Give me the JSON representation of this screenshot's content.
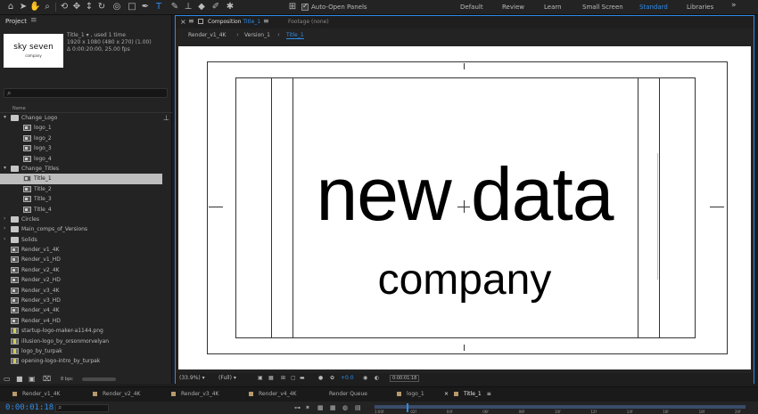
{
  "workspaces": {
    "auto_open": "Auto-Open Panels",
    "items": [
      "Default",
      "Review",
      "Learn",
      "Small Screen",
      "Standard",
      "Libraries"
    ],
    "active": "Standard"
  },
  "project": {
    "title": "Project",
    "thumb_line1": "sky seven",
    "thumb_line2": "company",
    "info": [
      "Title_1 ▾ , used 1 time",
      "1920 x 1080  (480 x 270) (1.00)",
      "Δ 0:00:20:00, 25.00 fps"
    ],
    "column_header": "Name",
    "items": [
      {
        "label": "Change_Logo",
        "type": "folder",
        "open": true,
        "depth": 0
      },
      {
        "label": "logo_1",
        "type": "comp",
        "depth": 1
      },
      {
        "label": "logo_2",
        "type": "comp",
        "depth": 1
      },
      {
        "label": "logo_3",
        "type": "comp",
        "depth": 1
      },
      {
        "label": "logo_4",
        "type": "comp",
        "depth": 1
      },
      {
        "label": "Change_Titles",
        "type": "folder",
        "open": true,
        "depth": 0
      },
      {
        "label": "Title_1",
        "type": "comp",
        "depth": 1,
        "selected": true
      },
      {
        "label": "Title_2",
        "type": "comp",
        "depth": 1
      },
      {
        "label": "Title_3",
        "type": "comp",
        "depth": 1
      },
      {
        "label": "Title_4",
        "type": "comp",
        "depth": 1
      },
      {
        "label": "Circles",
        "type": "folder",
        "open": false,
        "depth": 0
      },
      {
        "label": "Main_comps_of_Versions",
        "type": "folder",
        "open": false,
        "depth": 0
      },
      {
        "label": "Solids",
        "type": "folder",
        "open": false,
        "depth": 0
      },
      {
        "label": "Render_v1_4K",
        "type": "comp",
        "depth": 0
      },
      {
        "label": "Render_v1_HD",
        "type": "comp",
        "depth": 0
      },
      {
        "label": "Render_v2_4K",
        "type": "comp",
        "depth": 0
      },
      {
        "label": "Render_v2_HD",
        "type": "comp",
        "depth": 0
      },
      {
        "label": "Render_v3_4K",
        "type": "comp",
        "depth": 0
      },
      {
        "label": "Render_v3_HD",
        "type": "comp",
        "depth": 0
      },
      {
        "label": "Render_v4_4K",
        "type": "comp",
        "depth": 0
      },
      {
        "label": "Render_v4_HD",
        "type": "comp",
        "depth": 0
      },
      {
        "label": "startup-logo-maker-a1144.png",
        "type": "footage",
        "depth": 0
      },
      {
        "label": "illusion-logo_by_orsonmorvelyan",
        "type": "footage",
        "depth": 0
      },
      {
        "label": "logo_by_turpak",
        "type": "footage",
        "depth": 0
      },
      {
        "label": "opening-logo-intro_by_turpak",
        "type": "footage",
        "depth": 0
      }
    ],
    "bpc": "8 bpc"
  },
  "composition": {
    "tab_prefix": "Composition",
    "tab_name": "Title_1",
    "footage_tab": "Footage (none)",
    "breadcrumbs": [
      "Render_v1_4K",
      "Version_1",
      "Title_1"
    ],
    "text_main": "new data",
    "text_sub": "company",
    "zoom": "(33.9%)",
    "resolution": "(Full)",
    "exposure": "+0.0",
    "timecode": "0:00:01:18"
  },
  "timeline_tabs": [
    "Render_v1_4K",
    "Render_v2_4K",
    "Render_v3_4K",
    "Render_v4_4K",
    "Render Queue",
    "logo_1",
    "Title_1"
  ],
  "timeline": {
    "timecode": "0:00:01:18",
    "ticks": [
      "1:00f",
      "02f",
      "04f",
      "06f",
      "08f",
      "10f",
      "12f",
      "14f",
      "16f",
      "18f",
      "20f"
    ]
  },
  "colors": {
    "accent": "#2d8ceb",
    "panel": "#232323",
    "selection": "#bdbdbd"
  }
}
